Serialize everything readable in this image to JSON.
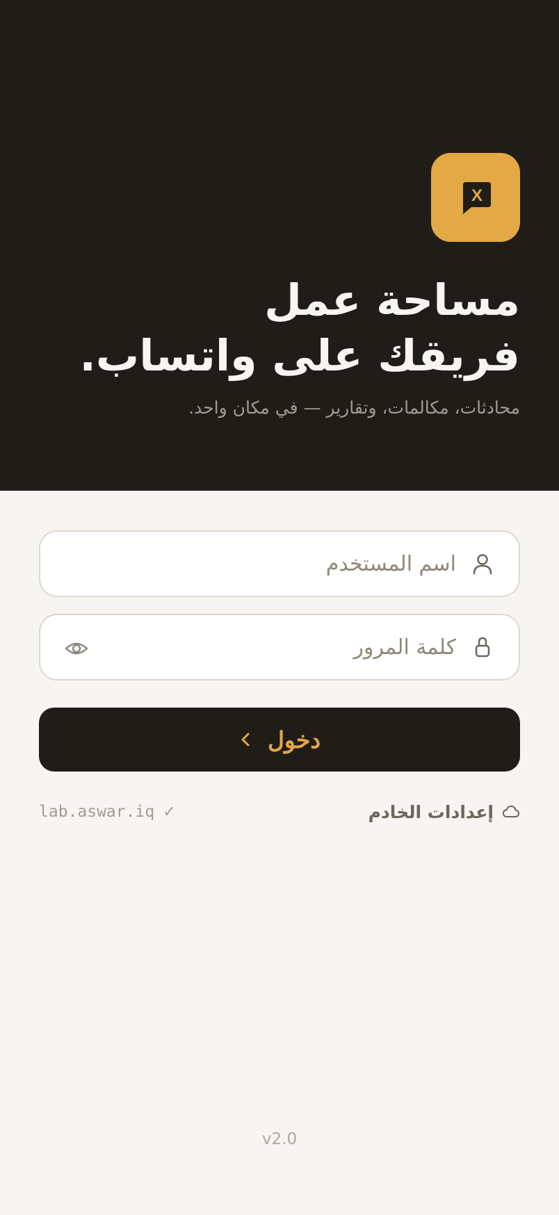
{
  "hero": {
    "title_line1": "مساحة عمل",
    "title_line2": "فريقك على واتساب.",
    "subtitle": "محادثات، مكالمات، وتقارير — في مكان واحد.",
    "logo_letter": "X",
    "logo_icon": "chat-bubble-x-icon"
  },
  "form": {
    "username_placeholder": "اسم المستخدم",
    "password_placeholder": "كلمة المرور",
    "login_label": "دخول"
  },
  "server": {
    "settings_label": "إعدادات الخادم",
    "domain": "lab.aswar.iq",
    "verified_mark": "✓"
  },
  "footer": {
    "version": "v2.0"
  },
  "colors": {
    "dark": "#201c17",
    "accent": "#e3a945",
    "background": "#f7f5f1"
  }
}
